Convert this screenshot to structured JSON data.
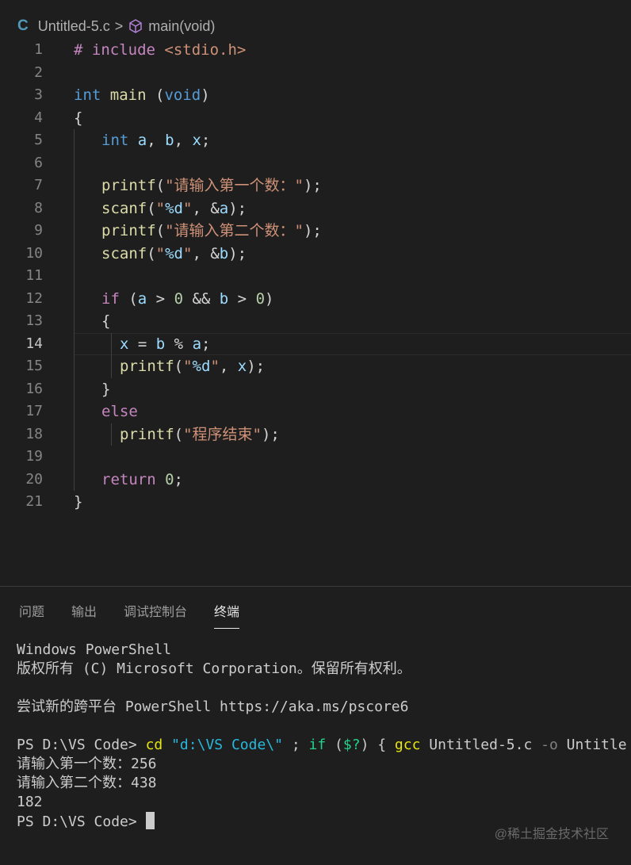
{
  "breadcrumb": {
    "lang_icon": "C",
    "file": "Untitled-5.c",
    "separator": ">",
    "symbol_icon": "cube-icon",
    "symbol": "main(void)"
  },
  "editor": {
    "current_line": 14,
    "lines": [
      {
        "n": "1",
        "indent": 0,
        "tokens": [
          {
            "t": "# include",
            "c": "ctl"
          },
          {
            "t": " ",
            "c": "pun"
          },
          {
            "t": "<stdio.h>",
            "c": "str"
          }
        ]
      },
      {
        "n": "2",
        "indent": 0,
        "tokens": []
      },
      {
        "n": "3",
        "indent": 0,
        "tokens": [
          {
            "t": "int",
            "c": "kw"
          },
          {
            "t": " ",
            "c": "pun"
          },
          {
            "t": "main",
            "c": "fn"
          },
          {
            "t": " (",
            "c": "pun"
          },
          {
            "t": "void",
            "c": "kw"
          },
          {
            "t": ")",
            "c": "pun"
          }
        ]
      },
      {
        "n": "4",
        "indent": 0,
        "tokens": [
          {
            "t": "{",
            "c": "pun"
          }
        ]
      },
      {
        "n": "5",
        "indent": 1,
        "tokens": [
          {
            "t": "int",
            "c": "kw"
          },
          {
            "t": " ",
            "c": "pun"
          },
          {
            "t": "a",
            "c": "var"
          },
          {
            "t": ", ",
            "c": "pun"
          },
          {
            "t": "b",
            "c": "var"
          },
          {
            "t": ", ",
            "c": "pun"
          },
          {
            "t": "x",
            "c": "var"
          },
          {
            "t": ";",
            "c": "pun"
          }
        ]
      },
      {
        "n": "6",
        "indent": 1,
        "tokens": []
      },
      {
        "n": "7",
        "indent": 1,
        "tokens": [
          {
            "t": "printf",
            "c": "fn"
          },
          {
            "t": "(",
            "c": "pun"
          },
          {
            "t": "\"请输入第一个数：\"",
            "c": "str"
          },
          {
            "t": ");",
            "c": "pun"
          }
        ]
      },
      {
        "n": "8",
        "indent": 1,
        "tokens": [
          {
            "t": "scanf",
            "c": "fn"
          },
          {
            "t": "(",
            "c": "pun"
          },
          {
            "t": "\"",
            "c": "str"
          },
          {
            "t": "%d",
            "c": "esc"
          },
          {
            "t": "\"",
            "c": "str"
          },
          {
            "t": ", &",
            "c": "pun"
          },
          {
            "t": "a",
            "c": "var"
          },
          {
            "t": ");",
            "c": "pun"
          }
        ]
      },
      {
        "n": "9",
        "indent": 1,
        "tokens": [
          {
            "t": "printf",
            "c": "fn"
          },
          {
            "t": "(",
            "c": "pun"
          },
          {
            "t": "\"请输入第二个数：\"",
            "c": "str"
          },
          {
            "t": ");",
            "c": "pun"
          }
        ]
      },
      {
        "n": "10",
        "indent": 1,
        "tokens": [
          {
            "t": "scanf",
            "c": "fn"
          },
          {
            "t": "(",
            "c": "pun"
          },
          {
            "t": "\"",
            "c": "str"
          },
          {
            "t": "%d",
            "c": "esc"
          },
          {
            "t": "\"",
            "c": "str"
          },
          {
            "t": ", &",
            "c": "pun"
          },
          {
            "t": "b",
            "c": "var"
          },
          {
            "t": ");",
            "c": "pun"
          }
        ]
      },
      {
        "n": "11",
        "indent": 1,
        "tokens": []
      },
      {
        "n": "12",
        "indent": 1,
        "tokens": [
          {
            "t": "if",
            "c": "ctl"
          },
          {
            "t": " (",
            "c": "pun"
          },
          {
            "t": "a",
            "c": "var"
          },
          {
            "t": " > ",
            "c": "pun"
          },
          {
            "t": "0",
            "c": "num"
          },
          {
            "t": " && ",
            "c": "pun"
          },
          {
            "t": "b",
            "c": "var"
          },
          {
            "t": " > ",
            "c": "pun"
          },
          {
            "t": "0",
            "c": "num"
          },
          {
            "t": ")",
            "c": "pun"
          }
        ]
      },
      {
        "n": "13",
        "indent": 1,
        "tokens": [
          {
            "t": "{",
            "c": "pun"
          }
        ]
      },
      {
        "n": "14",
        "indent": 2,
        "tokens": [
          {
            "t": "x",
            "c": "var"
          },
          {
            "t": " = ",
            "c": "pun"
          },
          {
            "t": "b",
            "c": "var"
          },
          {
            "t": " % ",
            "c": "pun"
          },
          {
            "t": "a",
            "c": "var"
          },
          {
            "t": ";",
            "c": "pun"
          }
        ]
      },
      {
        "n": "15",
        "indent": 2,
        "tokens": [
          {
            "t": "printf",
            "c": "fn"
          },
          {
            "t": "(",
            "c": "pun"
          },
          {
            "t": "\"",
            "c": "str"
          },
          {
            "t": "%d",
            "c": "esc"
          },
          {
            "t": "\"",
            "c": "str"
          },
          {
            "t": ", ",
            "c": "pun"
          },
          {
            "t": "x",
            "c": "var"
          },
          {
            "t": ");",
            "c": "pun"
          }
        ]
      },
      {
        "n": "16",
        "indent": 1,
        "tokens": [
          {
            "t": "}",
            "c": "pun"
          }
        ]
      },
      {
        "n": "17",
        "indent": 1,
        "tokens": [
          {
            "t": "else",
            "c": "ctl"
          }
        ]
      },
      {
        "n": "18",
        "indent": 2,
        "tokens": [
          {
            "t": "printf",
            "c": "fn"
          },
          {
            "t": "(",
            "c": "pun"
          },
          {
            "t": "\"程序结束\"",
            "c": "str"
          },
          {
            "t": ");",
            "c": "pun"
          }
        ]
      },
      {
        "n": "19",
        "indent": 1,
        "tokens": []
      },
      {
        "n": "20",
        "indent": 1,
        "tokens": [
          {
            "t": "return",
            "c": "ctl"
          },
          {
            "t": " ",
            "c": "pun"
          },
          {
            "t": "0",
            "c": "num"
          },
          {
            "t": ";",
            "c": "pun"
          }
        ]
      },
      {
        "n": "21",
        "indent": 0,
        "tokens": [
          {
            "t": "}",
            "c": "pun"
          }
        ]
      }
    ]
  },
  "panel": {
    "tabs": [
      {
        "label": "问题"
      },
      {
        "label": "输出"
      },
      {
        "label": "调试控制台"
      },
      {
        "label": "终端",
        "active": true
      }
    ],
    "terminal": [
      [
        {
          "t": "Windows PowerShell",
          "c": ""
        }
      ],
      [
        {
          "t": "版权所有 (C) Microsoft Corporation。保留所有权利。",
          "c": ""
        }
      ],
      [],
      [
        {
          "t": "尝试新的跨平台 PowerShell https://aka.ms/pscore6",
          "c": ""
        }
      ],
      [],
      [
        {
          "t": "PS D:\\VS Code> ",
          "c": ""
        },
        {
          "t": "cd",
          "c": "t-yellow"
        },
        {
          "t": " ",
          "c": ""
        },
        {
          "t": "\"d:\\VS Code\\\"",
          "c": "t-cyan"
        },
        {
          "t": " ; ",
          "c": ""
        },
        {
          "t": "if",
          "c": "t-green"
        },
        {
          "t": " (",
          "c": ""
        },
        {
          "t": "$?",
          "c": "t-green"
        },
        {
          "t": ") { ",
          "c": ""
        },
        {
          "t": "gcc",
          "c": "t-yellow"
        },
        {
          "t": " Untitled-5.c ",
          "c": ""
        },
        {
          "t": "-o",
          "c": "t-gray"
        },
        {
          "t": " Untitle",
          "c": ""
        }
      ],
      [
        {
          "t": "请输入第一个数：256",
          "c": ""
        }
      ],
      [
        {
          "t": "请输入第二个数：438",
          "c": ""
        }
      ],
      [
        {
          "t": "182",
          "c": ""
        }
      ],
      [
        {
          "t": "PS D:\\VS Code> ",
          "c": ""
        }
      ]
    ]
  },
  "watermark": "@稀土掘金技术社区"
}
